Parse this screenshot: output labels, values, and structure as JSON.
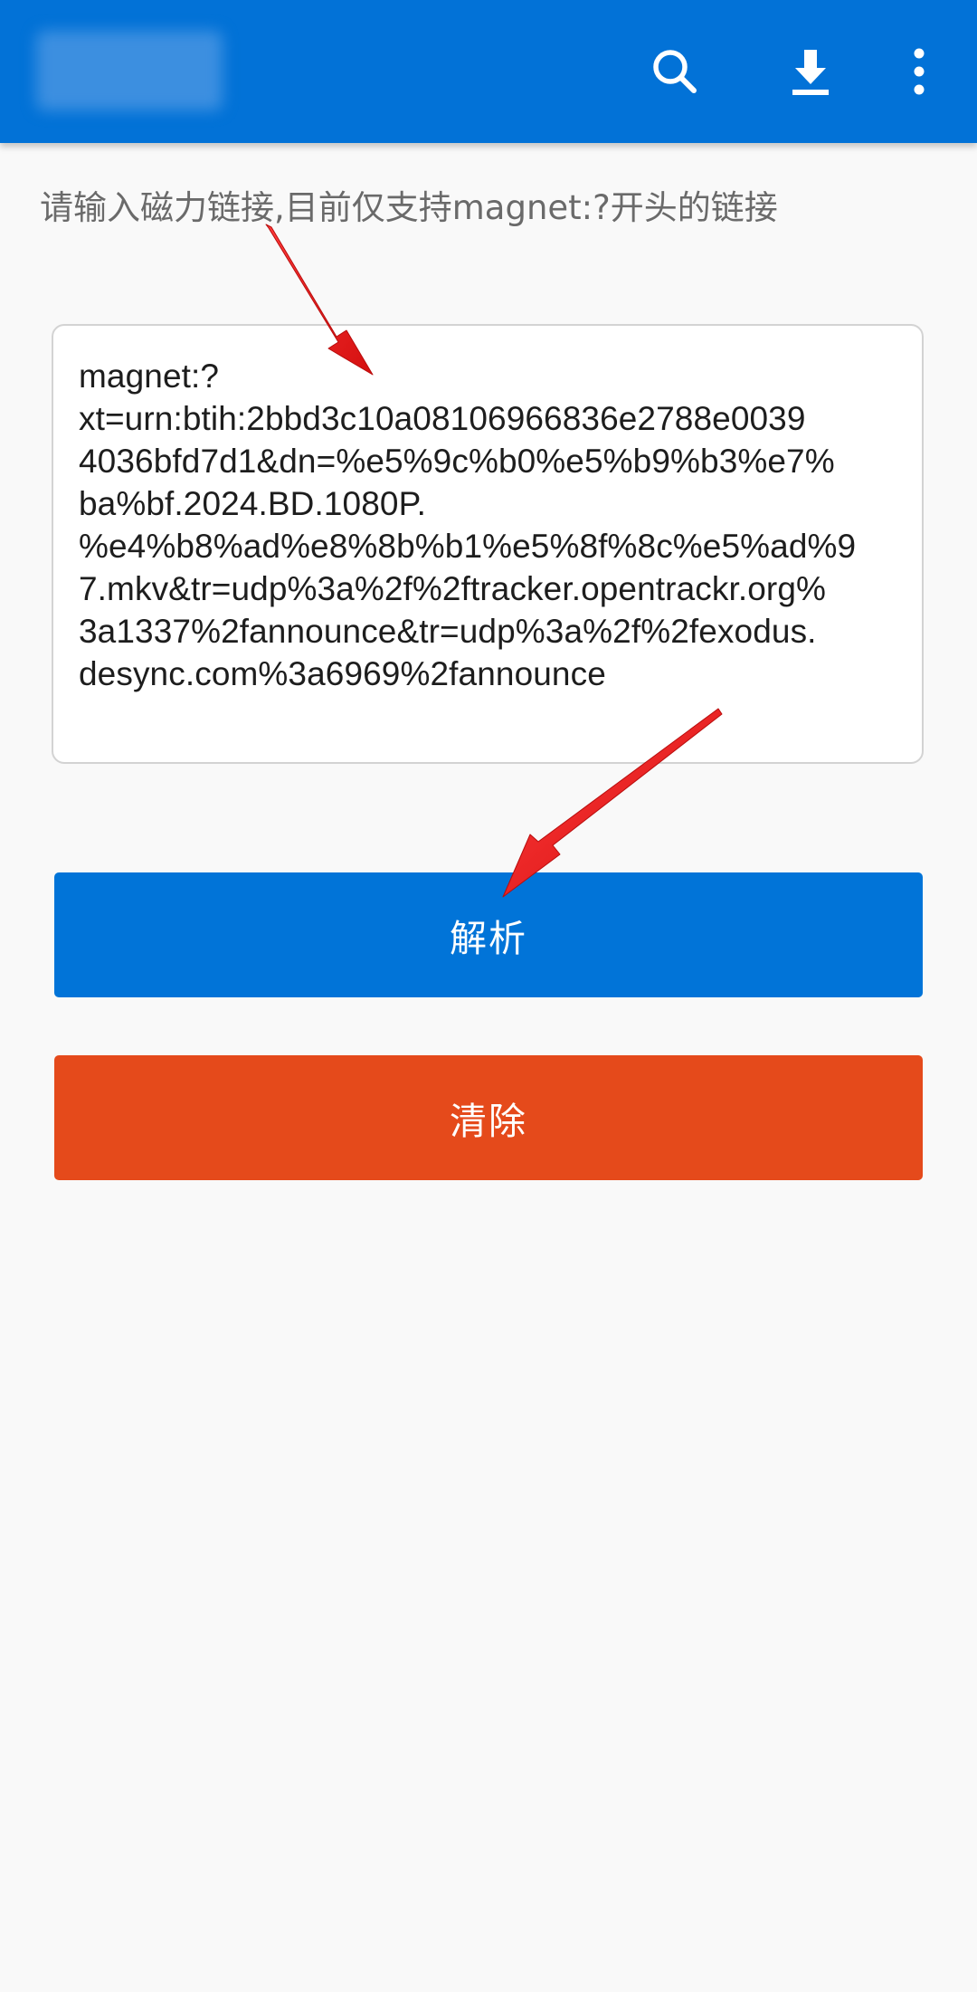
{
  "colors": {
    "appbar": "#0272d7",
    "primary_button": "#0174d8",
    "danger_button": "#e54a1b",
    "background": "#f9f9f9",
    "annotation_arrow": "#e21b1b"
  },
  "appbar": {
    "icons": [
      "search-icon",
      "download-icon",
      "more-vert-icon"
    ]
  },
  "hint": "请输入磁力链接,目前仅支持magnet:?开头的链接",
  "magnet_input": {
    "lines": [
      "magnet:?",
      "xt=urn:btih:2bbd3c10a08106966836e2788e0039",
      "4036bfd7d1&dn=%e5%9c%b0%e5%b9%b3%e7%",
      "ba%bf.2024.BD.1080P.",
      "%e4%b8%ad%e8%8b%b1%e5%8f%8c%e5%ad%9",
      "7.mkv&tr=udp%3a%2f%2ftracker.opentrackr.org%",
      "3a1337%2fannounce&tr=udp%3a%2f%2fexodus.",
      "desync.com%3a6969%2fannounce"
    ]
  },
  "buttons": {
    "parse": "解析",
    "clear": "清除"
  }
}
